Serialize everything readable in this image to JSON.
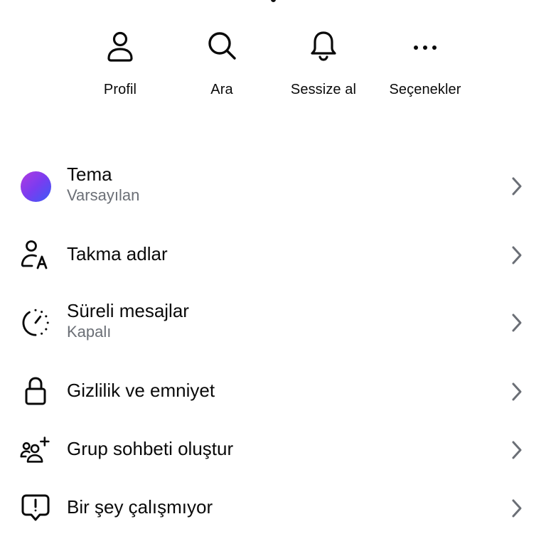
{
  "actions": [
    {
      "label": "Profil",
      "icon": "person-icon"
    },
    {
      "label": "Ara",
      "icon": "search-icon"
    },
    {
      "label": "Sessize al",
      "icon": "bell-icon"
    },
    {
      "label": "Seçenekler",
      "icon": "more-horizontal-icon"
    }
  ],
  "settings": {
    "theme": {
      "title": "Tema",
      "subtitle": "Varsayılan",
      "color_start": "#b13ae0",
      "color_end": "#3a5cf6"
    },
    "nicknames": {
      "title": "Takma adlar"
    },
    "disappearing": {
      "title": "Süreli mesajlar",
      "subtitle": "Kapalı"
    },
    "privacy": {
      "title": "Gizlilik ve emniyet"
    },
    "group": {
      "title": "Grup sohbeti oluştur"
    },
    "report": {
      "title": "Bir şey çalışmıyor"
    }
  },
  "colors": {
    "text": "#0a0a0a",
    "subtitle": "#6b6f76",
    "chevron": "#6b6f76"
  }
}
